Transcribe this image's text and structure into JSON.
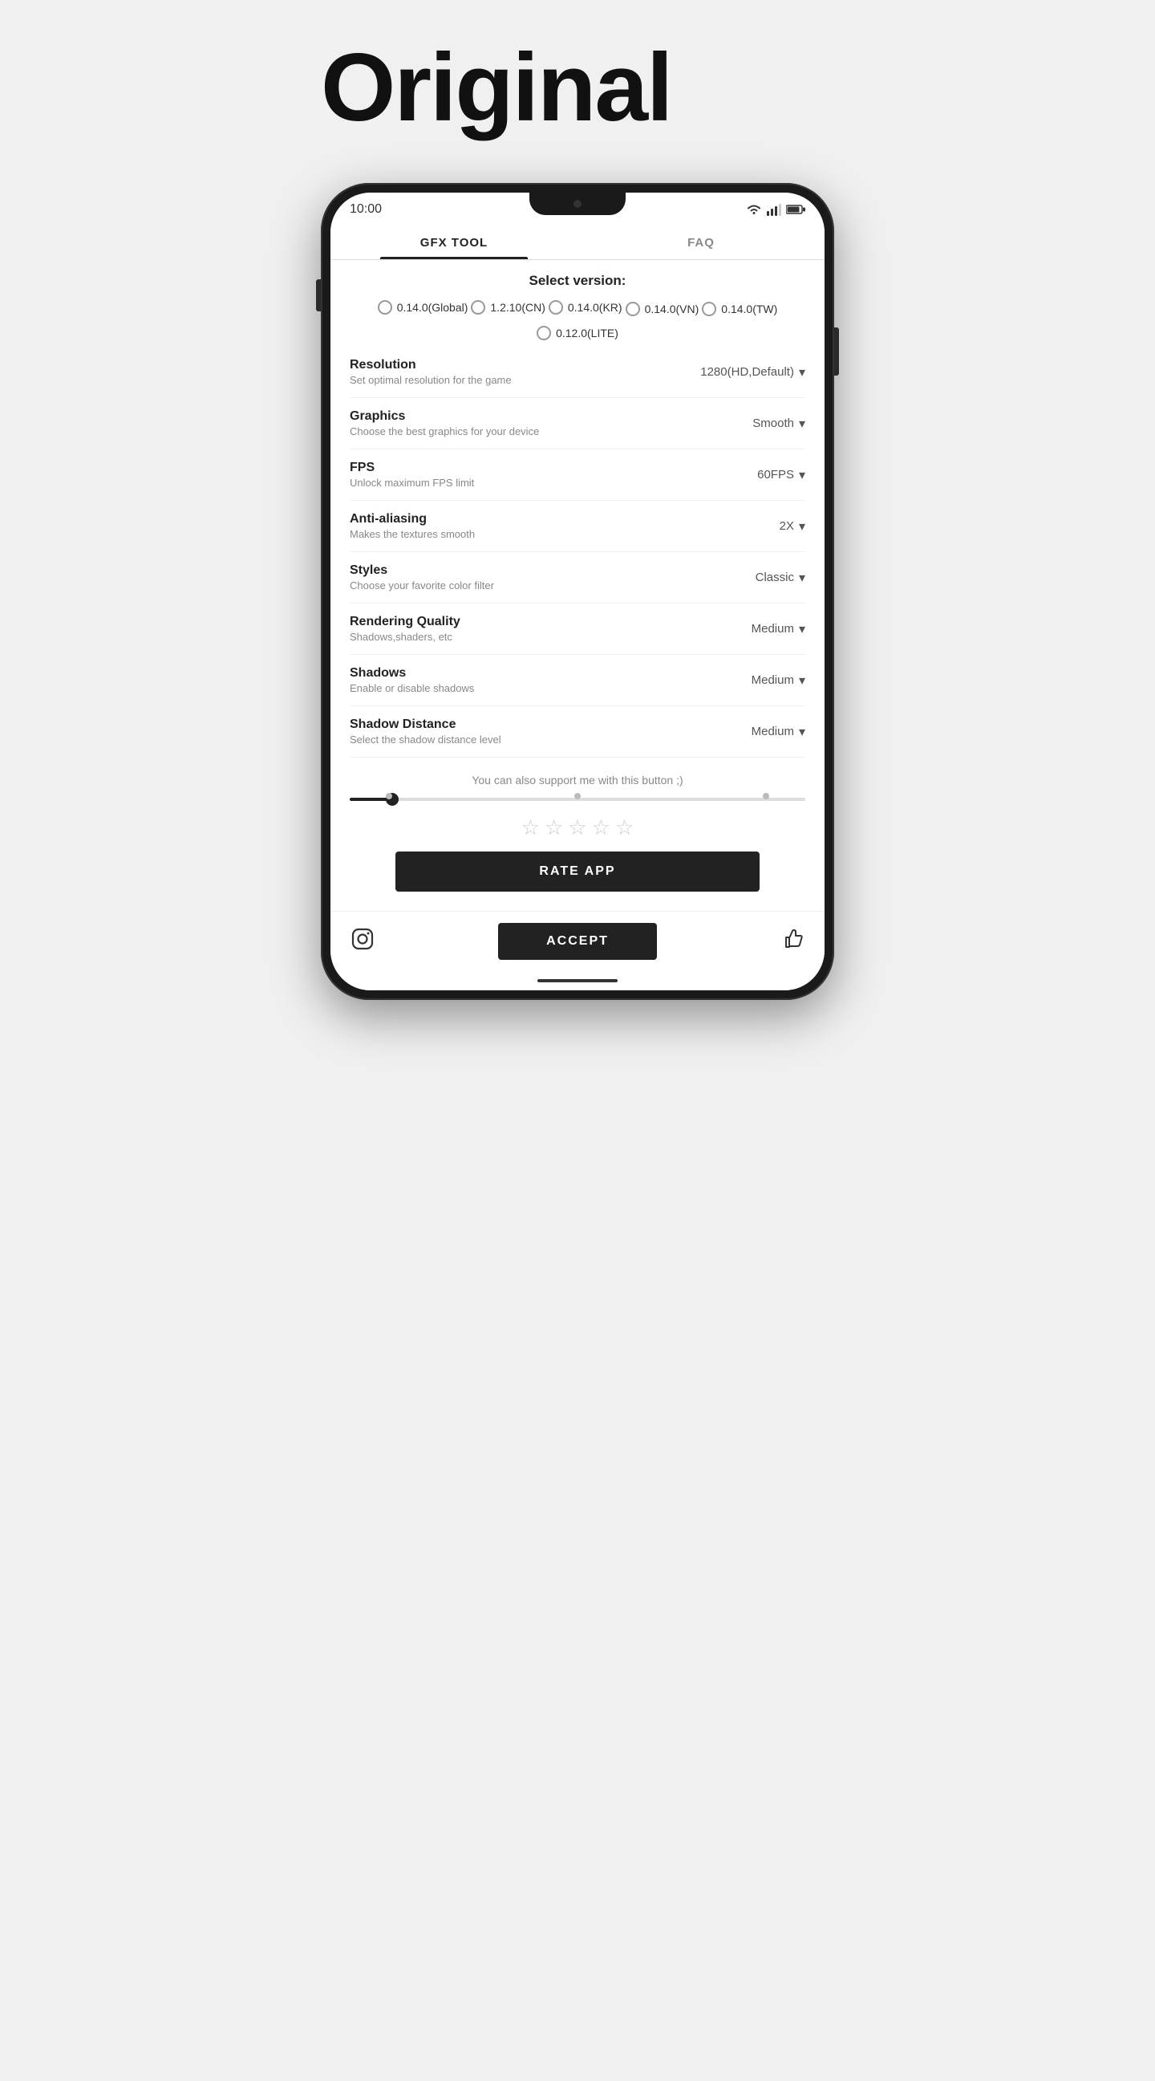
{
  "page": {
    "title": "Original"
  },
  "status_bar": {
    "time": "10:00"
  },
  "tabs": [
    {
      "label": "GFX TOOL",
      "active": true
    },
    {
      "label": "FAQ",
      "active": false
    }
  ],
  "select_version": {
    "title": "Select version:",
    "options": [
      {
        "label": "0.14.0(Global)",
        "selected": false
      },
      {
        "label": "1.2.10(CN)",
        "selected": false
      },
      {
        "label": "0.14.0(KR)",
        "selected": false
      },
      {
        "label": "0.14.0(VN)",
        "selected": false
      },
      {
        "label": "0.14.0(TW)",
        "selected": false
      },
      {
        "label": "0.12.0(LITE)",
        "selected": false
      }
    ]
  },
  "settings": [
    {
      "label": "Resolution",
      "description": "Set optimal resolution for the game",
      "value": "1280(HD,Default)"
    },
    {
      "label": "Graphics",
      "description": "Choose the best graphics for your device",
      "value": "Smooth"
    },
    {
      "label": "FPS",
      "description": "Unlock maximum FPS limit",
      "value": "60FPS"
    },
    {
      "label": "Anti-aliasing",
      "description": "Makes the textures smooth",
      "value": "2X"
    },
    {
      "label": "Styles",
      "description": "Choose your favorite color filter",
      "value": "Classic"
    },
    {
      "label": "Rendering Quality",
      "description": "Shadows,shaders, etc",
      "value": "Medium"
    },
    {
      "label": "Shadows",
      "description": "Enable or disable shadows",
      "value": "Medium"
    },
    {
      "label": "Shadow Distance",
      "description": "Select the shadow distance level",
      "value": "Medium"
    }
  ],
  "support": {
    "text": "You can also support me with this button ;)"
  },
  "rate_section": {
    "stars": [
      "☆",
      "☆",
      "☆",
      "☆",
      "☆"
    ],
    "button_label": "RATE APP"
  },
  "bottom_bar": {
    "accept_label": "ACCEPT",
    "instagram_icon": "instagram",
    "like_icon": "thumbs-up"
  }
}
